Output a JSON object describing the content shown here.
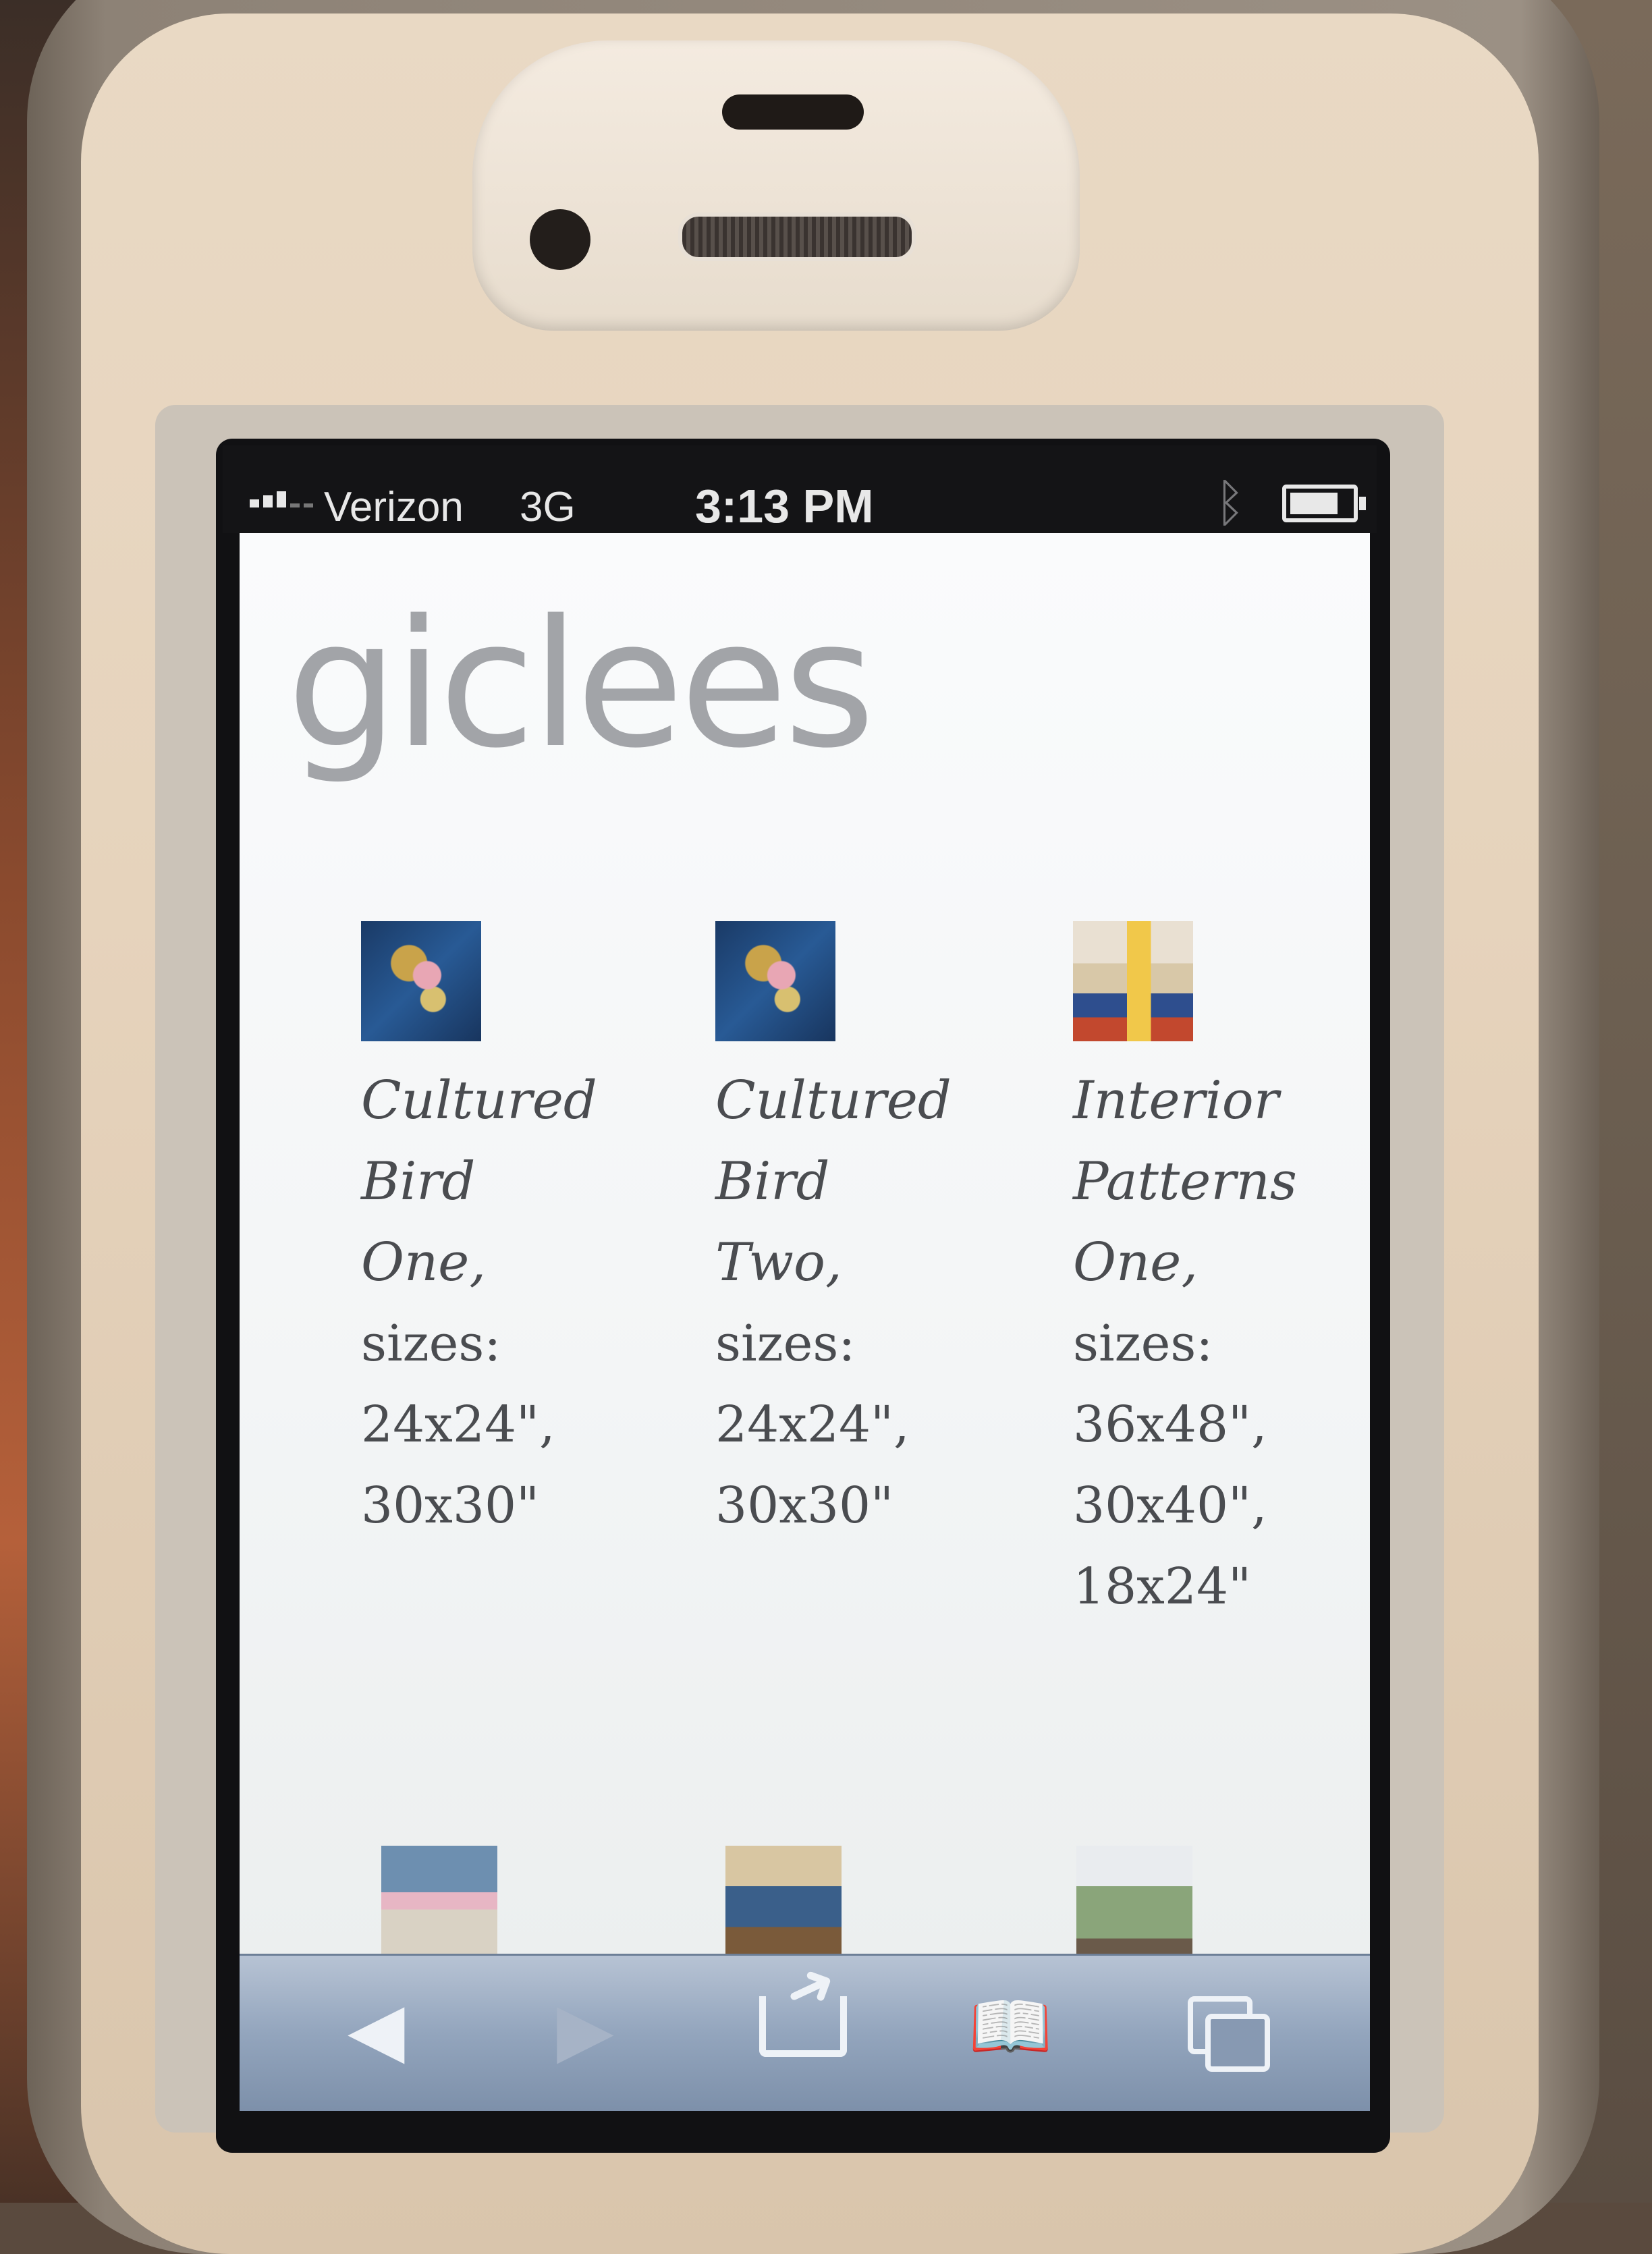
{
  "status_bar": {
    "carrier": "Verizon",
    "network": "3G",
    "time": "3:13 PM",
    "icons": [
      "signal-icon",
      "bluetooth-icon",
      "battery-icon"
    ]
  },
  "page": {
    "title": "giclees",
    "items": [
      {
        "caption": "Cultured Bird One,",
        "sizes_label": "sizes:",
        "sizes": "24x24\", 30x30\""
      },
      {
        "caption": "Cultured Bird Two,",
        "sizes_label": "sizes:",
        "sizes": "24x24\", 30x30\""
      },
      {
        "caption": "Interior Patterns One,",
        "sizes_label": "sizes:",
        "sizes": "36x48\", 30x40\", 18x24\""
      }
    ]
  },
  "toolbar": {
    "buttons": [
      "back-icon",
      "forward-icon",
      "share-icon",
      "bookmarks-icon",
      "tabs-icon"
    ]
  }
}
